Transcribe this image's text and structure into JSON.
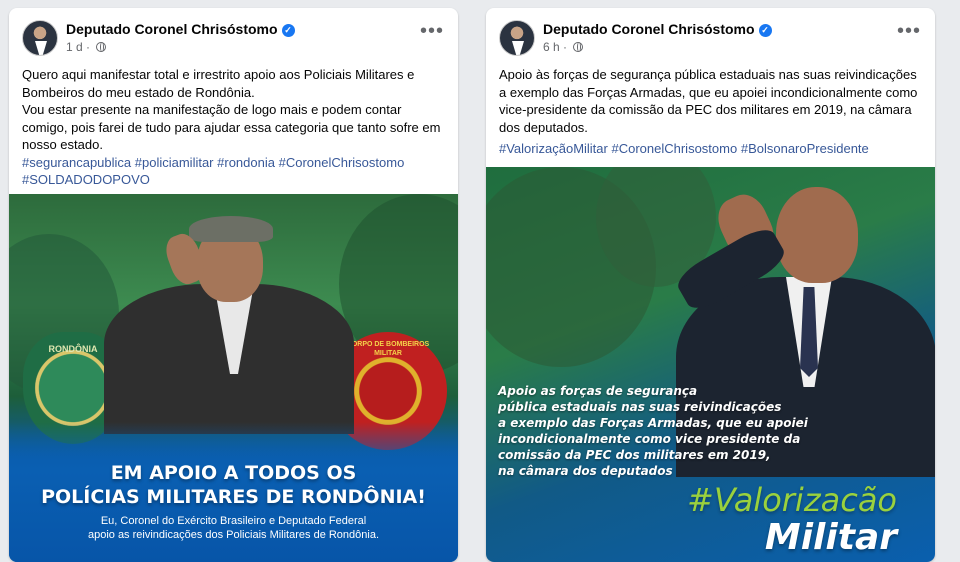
{
  "posts": [
    {
      "author": "Deputado Coronel Chrisóstomo",
      "verified_icon": "verified-check-icon",
      "time": "1 d",
      "privacy_icon": "globe-icon",
      "more": "•••",
      "text_lines": [
        "Quero aqui manifestar total e irrestrito apoio aos Policiais Militares e Bombeiros do meu estado de Rondônia.",
        "Vou estar presente na manifestação de logo mais e podem contar comigo, pois farei de tudo para ajudar essa categoria que tanto sofre em nosso estado."
      ],
      "hashtags": [
        "#segurancapublica",
        "#policiamilitar",
        "#rondonia",
        "#CoronelChrisostomo",
        "#SOLDADODOPOVO"
      ],
      "image": {
        "badge_left": "RONDÔNIA",
        "badge_right": "CORPO DE BOMBEIROS MILITAR",
        "headline_1": "EM APOIO A TODOS OS",
        "headline_2": "POLÍCIAS MILITARES DE RONDÔNIA!",
        "subline_1": "Eu, Coronel do Exército Brasileiro e Deputado Federal",
        "subline_2": "apoio as reivindicações dos Policiais Militares de Rondônia."
      }
    },
    {
      "author": "Deputado Coronel Chrisóstomo",
      "verified_icon": "verified-check-icon",
      "time": "6 h",
      "privacy_icon": "globe-icon",
      "more": "•••",
      "text_lines": [
        "Apoio às forças de segurança pública estaduais nas suas reivindicações a exemplo das Forças Armadas, que eu apoiei incondicionalmente como vice-presidente da comissão da PEC dos militares em 2019, na câmara dos deputados."
      ],
      "hashtags": [
        "#ValorizaçãoMilitar",
        "#CoronelChrisostomo",
        "#BolsonaroPresidente"
      ],
      "image": {
        "caption_lines": [
          "Apoio as forças de segurança",
          "pública estaduais nas suas reivindicações",
          "a exemplo das Forças Armadas, que eu apoiei",
          "incondicionalmente como vice presidente da",
          "comissão da PEC dos militares em 2019,",
          "na câmara dos deputados"
        ],
        "hash_title": "#Valorizacão",
        "hash_title_2": "Militar"
      }
    }
  ],
  "colors": {
    "link": "#385898",
    "verified": "#1877f2",
    "muted": "#65676b",
    "lime": "#9ad13d"
  }
}
